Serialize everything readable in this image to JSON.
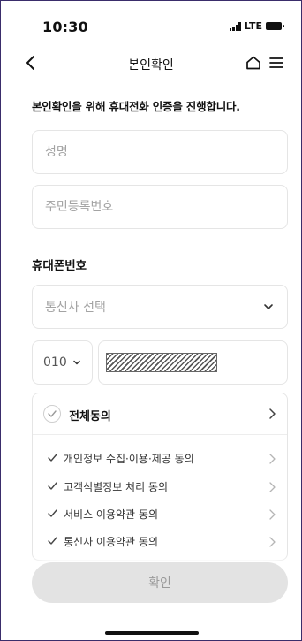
{
  "status_bar": {
    "time": "10:30",
    "network": "LTE"
  },
  "header": {
    "title": "본인확인"
  },
  "intro": "본인확인을 위해 휴대전화 인증을 진행합니다.",
  "name_field": {
    "placeholder": "성명",
    "value": ""
  },
  "rrn_field": {
    "placeholder": "주민등록번호",
    "value": ""
  },
  "phone_section": {
    "label": "휴대폰번호",
    "carrier_placeholder": "통신사 선택",
    "prefix": "010"
  },
  "agreements": {
    "all_label": "전체동의",
    "items": [
      {
        "label": "개인정보 수집·이용·제공 동의"
      },
      {
        "label": "고객식별정보 처리 동의"
      },
      {
        "label": "서비스 이용약관 동의"
      },
      {
        "label": "통신사 이용약관 동의"
      }
    ]
  },
  "confirm_label": "확인",
  "colors": {
    "border": "#e5e5e5",
    "placeholder": "#a3a3a3",
    "button_disabled_bg": "#e3e3e3",
    "button_disabled_text": "#9a9a9a",
    "frame": "#3a2d6b"
  },
  "icons": [
    "back-icon",
    "home-icon",
    "menu-icon",
    "chevron-down-icon",
    "chevron-right-icon",
    "check-icon",
    "circle-check-icon"
  ]
}
